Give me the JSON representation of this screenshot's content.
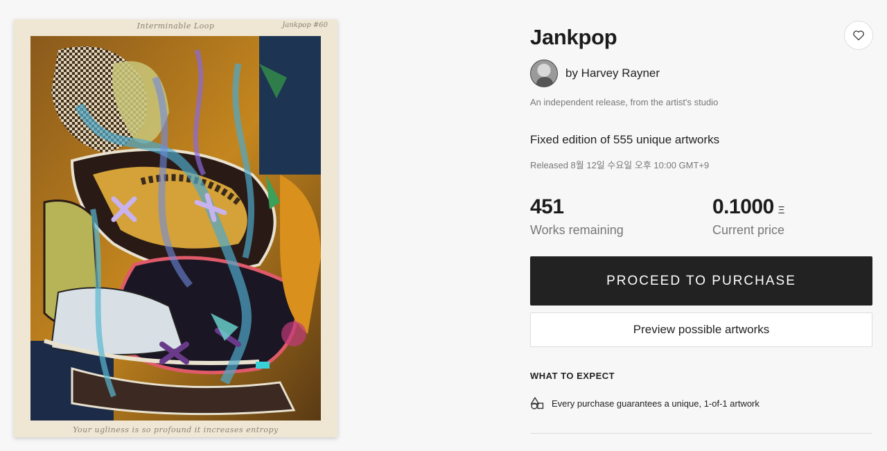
{
  "artwork": {
    "frame_top_text": "Interminable Loop",
    "frame_top_right_text": "Jankpop #60",
    "frame_bottom_text": "Your ugliness is so profound it increases entropy"
  },
  "project": {
    "title": "Jankpop",
    "artist": "by Harvey Rayner",
    "subtitle": "An independent release, from the artist's studio",
    "edition": "Fixed edition of 555 unique artworks",
    "released": "Released 8월 12일 수요일 오후 10:00 GMT+9"
  },
  "stats": {
    "remaining_value": "451",
    "remaining_label": "Works remaining",
    "price_value": "0.1000",
    "price_unit": "Ξ",
    "price_label": "Current price"
  },
  "actions": {
    "purchase_label": "PROCEED TO PURCHASE",
    "preview_label": "Preview possible artworks"
  },
  "expect": {
    "heading": "WHAT TO EXPECT",
    "items": [
      {
        "text": "Every purchase guarantees a unique, 1-of-1 artwork",
        "icon": "shapes-icon"
      }
    ]
  },
  "colors": {
    "primary_button": "#222222",
    "background": "#f7f7f7"
  }
}
